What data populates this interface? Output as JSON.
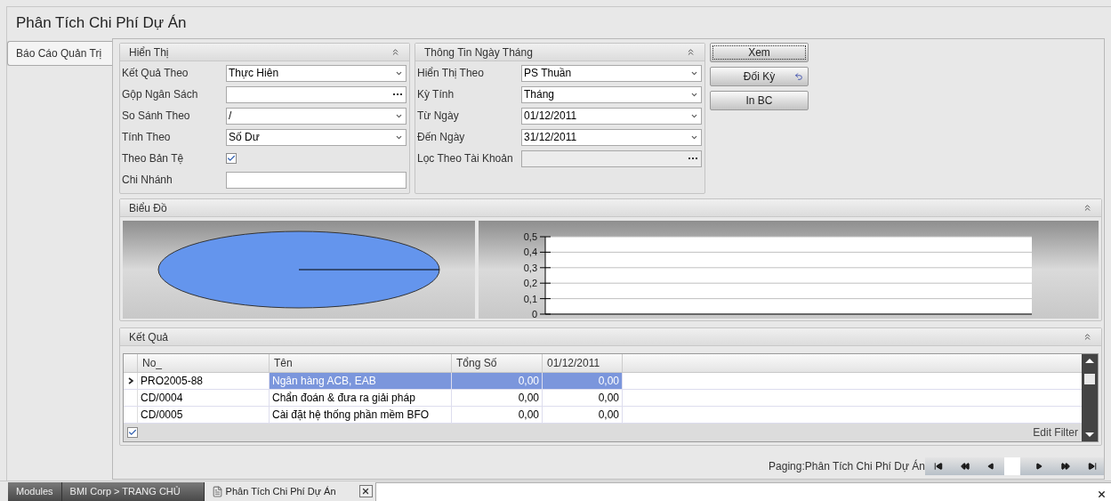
{
  "window": {
    "title": "Phân Tích Chi Phí Dự Án"
  },
  "side_tabs": [
    {
      "label": "Báo Cáo Quản Trị",
      "selected": true
    }
  ],
  "display_panel": {
    "title": "Hiển Thị",
    "fields": [
      {
        "label": "Kết Quả Theo",
        "kind": "combo",
        "value": "Thực Hiên"
      },
      {
        "label": "Gộp Ngân Sách",
        "kind": "lookup"
      },
      {
        "label": "So Sánh Theo",
        "kind": "combo",
        "value": "/"
      },
      {
        "label": "Tính Theo",
        "kind": "combo",
        "value": "Số Dư"
      },
      {
        "label": "Theo Bản Tệ",
        "kind": "checkbox",
        "checked": true
      },
      {
        "label": "Chi Nhánh",
        "kind": "text"
      }
    ]
  },
  "date_panel": {
    "title": "Thông Tin Ngày Tháng",
    "fields": [
      {
        "label": "Hiển Thị Theo",
        "kind": "combo",
        "value": "PS Thuần"
      },
      {
        "label": "Kỳ Tính",
        "kind": "combo",
        "value": "Tháng"
      },
      {
        "label": "Từ Ngày",
        "kind": "combo",
        "value": "01/12/2011"
      },
      {
        "label": "Đến Ngày",
        "kind": "combo",
        "value": "31/12/2011"
      },
      {
        "label": "Lọc Theo Tài Khoản",
        "kind": "lookup",
        "disabled": true
      }
    ]
  },
  "buttons": [
    {
      "label": "Xem",
      "focused": true,
      "icon": false
    },
    {
      "label": "Đối Kỳ",
      "focused": false,
      "icon": true
    },
    {
      "label": "In BC",
      "focused": false,
      "icon": false
    }
  ],
  "chart_panel": {
    "title": "Biểu Đồ",
    "y_axis_labels": [
      "0,5",
      "0,4",
      "0,3",
      "0,2",
      "0,1",
      "0"
    ]
  },
  "result_panel": {
    "title": "Kết Quả",
    "columns": [
      "No_",
      "Tên",
      "Tổng Số",
      "01/12/2011"
    ],
    "rows": [
      {
        "cells": [
          "PRO2005-88",
          "Ngân hàng ACB, EAB",
          "0,00",
          "0,00"
        ],
        "selected": true
      },
      {
        "cells": [
          "CD/0004",
          "Chẩn đoán & đưa ra giải pháp",
          "0,00",
          "0,00"
        ],
        "selected": false
      },
      {
        "cells": [
          "CD/0005",
          "Cài đặt hệ thống phần mềm BFO",
          "0,00",
          "0,00"
        ],
        "selected": false
      }
    ],
    "filter_checked": true,
    "edit_filter": "Edit Filter"
  },
  "paging": {
    "label": "Paging:Phân Tích Chi Phí Dự Án"
  },
  "taskbar": {
    "items": [
      {
        "label": "Modules",
        "kind": "module",
        "selected": false
      },
      {
        "label": "BMI Corp > TRANG CHỦ",
        "kind": "module",
        "selected": false
      },
      {
        "label": "Phân Tích Chi Phí Dự Án",
        "kind": "document",
        "selected": true
      }
    ]
  }
}
